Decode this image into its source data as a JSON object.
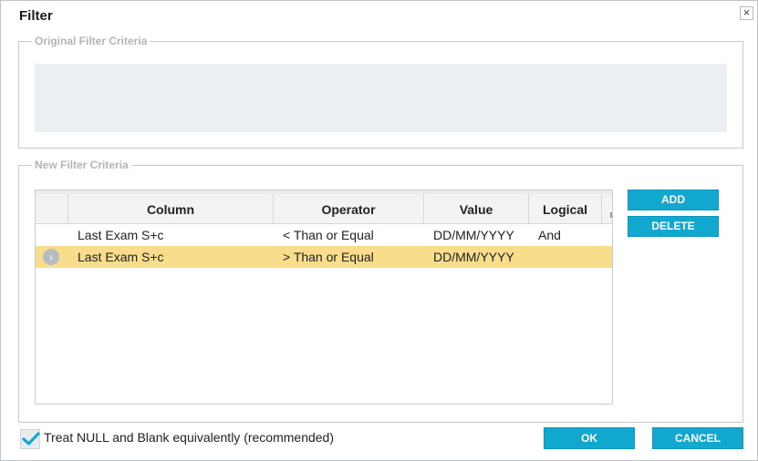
{
  "dialog": {
    "title": "Filter",
    "close_label": "×"
  },
  "original_criteria": {
    "legend": "Original Filter Criteria"
  },
  "new_criteria": {
    "legend": "New Filter Criteria",
    "columns": [
      "Column",
      "Operator",
      "Value",
      "Logical"
    ],
    "rows": [
      {
        "column": "Last Exam S+c",
        "operator": "< Than or Equal",
        "value": "DD/MM/YYYY",
        "logical": "And",
        "selected": false
      },
      {
        "column": "Last Exam S+c",
        "operator": "> Than or Equal",
        "value": "DD/MM/YYYY",
        "logical": "",
        "selected": true
      }
    ],
    "add_label": "ADD",
    "delete_label": "DELETE"
  },
  "footer": {
    "treat_null_label": "Treat NULL and Blank equivalently (recommended)",
    "treat_null_checked": true,
    "ok_label": "OK",
    "cancel_label": "CANCEL"
  },
  "colors": {
    "accent": "#12a7cf",
    "selected_row": "#f8de8c",
    "check": "#12a7cf"
  },
  "icons": {
    "row_indicator": "chevron-right-icon",
    "close": "close-icon",
    "checkbox": "check-icon"
  }
}
